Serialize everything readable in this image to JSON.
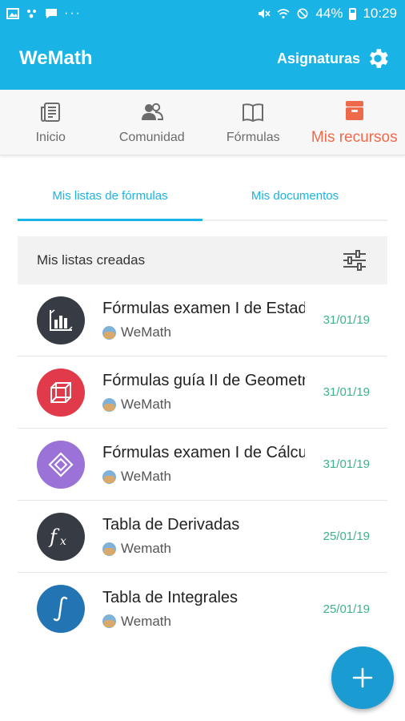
{
  "status_bar": {
    "battery": "44%",
    "time": "10:29",
    "dots": "···"
  },
  "app_bar": {
    "title": "WeMath",
    "subjects_label": "Asignaturas"
  },
  "nav": [
    {
      "label": "Inicio",
      "icon": "news-icon"
    },
    {
      "label": "Comunidad",
      "icon": "community-icon"
    },
    {
      "label": "Fórmulas",
      "icon": "book-icon"
    },
    {
      "label": "Mis recursos",
      "icon": "inbox-icon"
    }
  ],
  "tabs": {
    "formula_lists": "Mis listas de fórmulas",
    "documents": "Mis documentos"
  },
  "filter_bar": {
    "label": "Mis listas creadas"
  },
  "lists": [
    {
      "title": "Fórmulas examen I de Estadística",
      "author": "WeMath",
      "date": "31/01/19",
      "color": "#373b43",
      "icon": "bar-chart-icon"
    },
    {
      "title": "Fórmulas guía II de Geometría",
      "author": "WeMath",
      "date": "31/01/19",
      "color": "#e13a4a",
      "icon": "cube-icon"
    },
    {
      "title": "Fórmulas examen I de Cálculo",
      "author": "WeMath",
      "date": "31/01/19",
      "color": "#9b73d8",
      "icon": "diamond-icon"
    },
    {
      "title": "Tabla de Derivadas",
      "author": "Wemath",
      "date": "25/01/19",
      "color": "#373b43",
      "icon": "fx-icon"
    },
    {
      "title": "Tabla de Integrales",
      "author": "Wemath",
      "date": "25/01/19",
      "color": "#2374b3",
      "icon": "integral-icon"
    }
  ],
  "colors": {
    "primary": "#1ab3e6",
    "active_nav": "#ef6a4a",
    "date": "#3bb38d",
    "fab": "#1a9bd1"
  }
}
